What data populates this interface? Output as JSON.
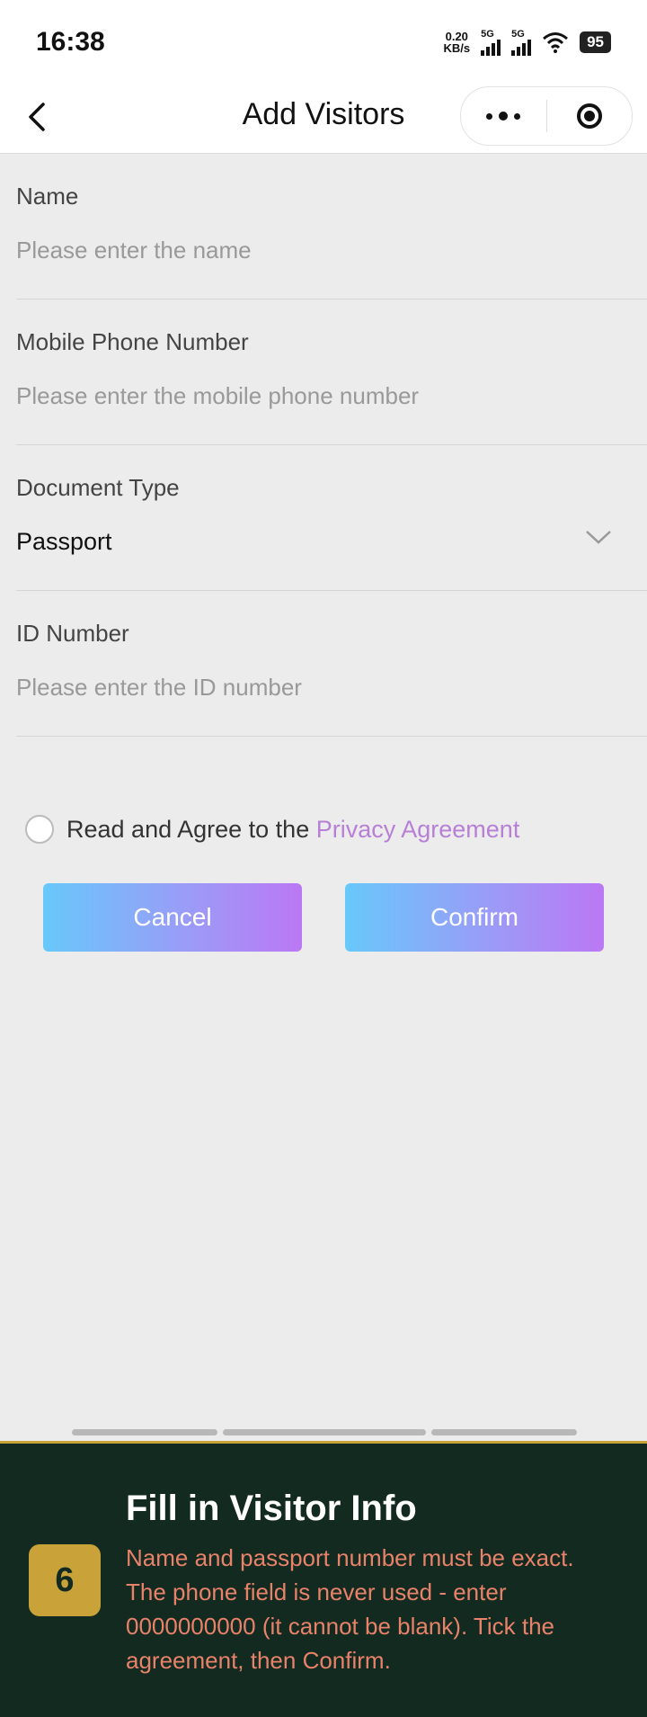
{
  "status_bar": {
    "time": "16:38",
    "net_speed_value": "0.20",
    "net_speed_unit": "KB/s",
    "sim1_label": "5G",
    "sim2_label": "5G",
    "battery": "95"
  },
  "nav": {
    "title": "Add Visitors"
  },
  "form": {
    "name": {
      "label": "Name",
      "placeholder": "Please enter the name"
    },
    "phone": {
      "label": "Mobile Phone Number",
      "placeholder": "Please enter the mobile phone number"
    },
    "document_type": {
      "label": "Document Type",
      "value": "Passport"
    },
    "id_number": {
      "label": "ID Number",
      "placeholder": "Please enter the ID number"
    }
  },
  "agreement": {
    "text": "Read and Agree to the ",
    "link": "Privacy Agreement",
    "checked": false
  },
  "buttons": {
    "cancel": "Cancel",
    "confirm": "Confirm"
  },
  "instruction": {
    "step": "6",
    "title": "Fill in Visitor Info",
    "body": "Name and passport number must be exact. The phone field is never used - enter 0000000000 (it cannot be blank). Tick the agreement, then Confirm."
  },
  "colors": {
    "button_gradient_start": "#67c8fb",
    "button_gradient_end": "#bb78f4",
    "link": "#b77fd6",
    "panel_bg": "#122a1f",
    "panel_accent": "#c9a23a",
    "panel_text": "#e8826a"
  }
}
